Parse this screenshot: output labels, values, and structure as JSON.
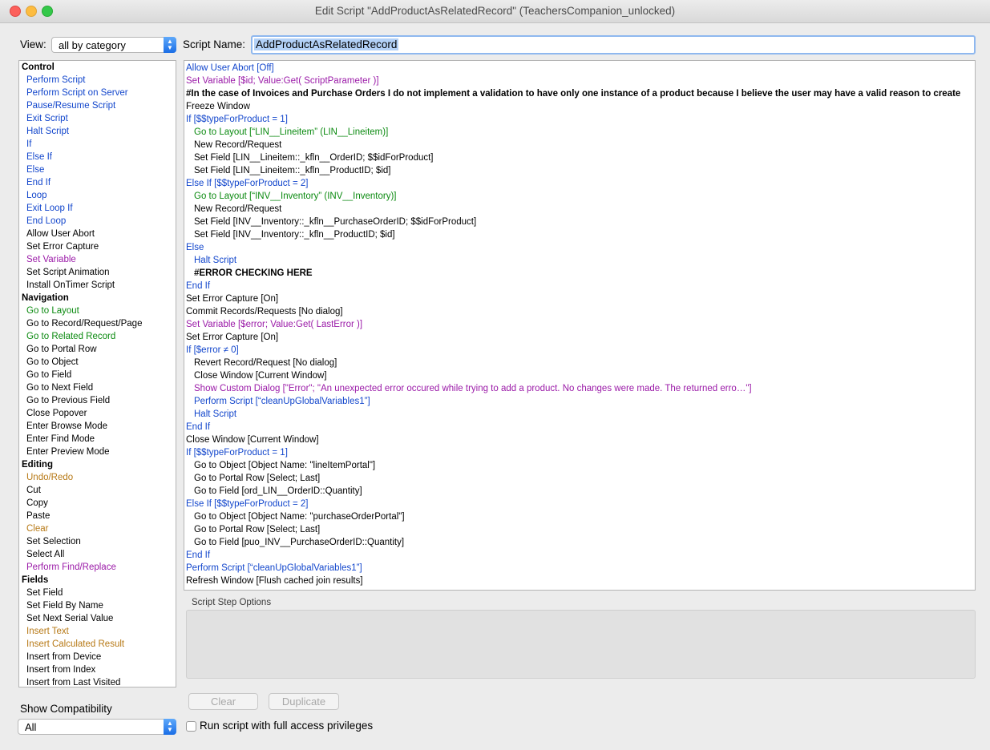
{
  "window": {
    "title": "Edit Script \"AddProductAsRelatedRecord\" (TeachersCompanion_unlocked)"
  },
  "view": {
    "label": "View:",
    "selected": "all by category"
  },
  "script_name": {
    "label": "Script Name:",
    "value": "AddProductAsRelatedRecord"
  },
  "steps": [
    {
      "text": "Control",
      "kind": "cat"
    },
    {
      "text": "Perform Script",
      "color": "blue"
    },
    {
      "text": "Perform Script on Server",
      "color": "blue"
    },
    {
      "text": "Pause/Resume Script",
      "color": "blue"
    },
    {
      "text": "Exit Script",
      "color": "blue"
    },
    {
      "text": "Halt Script",
      "color": "blue"
    },
    {
      "text": "If",
      "color": "blue"
    },
    {
      "text": "Else If",
      "color": "blue"
    },
    {
      "text": "Else",
      "color": "blue"
    },
    {
      "text": "End If",
      "color": "blue"
    },
    {
      "text": "Loop",
      "color": "blue"
    },
    {
      "text": "Exit Loop If",
      "color": "blue"
    },
    {
      "text": "End Loop",
      "color": "blue"
    },
    {
      "text": "Allow User Abort",
      "color": "black"
    },
    {
      "text": "Set Error Capture",
      "color": "black"
    },
    {
      "text": "Set Variable",
      "color": "purple"
    },
    {
      "text": "Set Script Animation",
      "color": "black"
    },
    {
      "text": "Install OnTimer Script",
      "color": "black"
    },
    {
      "text": "Navigation",
      "kind": "cat"
    },
    {
      "text": "Go to Layout",
      "color": "green"
    },
    {
      "text": "Go to Record/Request/Page",
      "color": "black"
    },
    {
      "text": "Go to Related Record",
      "color": "green"
    },
    {
      "text": "Go to Portal Row",
      "color": "black"
    },
    {
      "text": "Go to Object",
      "color": "black"
    },
    {
      "text": "Go to Field",
      "color": "black"
    },
    {
      "text": "Go to Next Field",
      "color": "black"
    },
    {
      "text": "Go to Previous Field",
      "color": "black"
    },
    {
      "text": "Close Popover",
      "color": "black"
    },
    {
      "text": "Enter Browse Mode",
      "color": "black"
    },
    {
      "text": "Enter Find Mode",
      "color": "black"
    },
    {
      "text": "Enter Preview Mode",
      "color": "black"
    },
    {
      "text": "Editing",
      "kind": "cat"
    },
    {
      "text": "Undo/Redo",
      "color": "orange"
    },
    {
      "text": "Cut",
      "color": "black"
    },
    {
      "text": "Copy",
      "color": "black"
    },
    {
      "text": "Paste",
      "color": "black"
    },
    {
      "text": "Clear",
      "color": "orange"
    },
    {
      "text": "Set Selection",
      "color": "black"
    },
    {
      "text": "Select All",
      "color": "black"
    },
    {
      "text": "Perform Find/Replace",
      "color": "purple"
    },
    {
      "text": "Fields",
      "kind": "cat"
    },
    {
      "text": "Set Field",
      "color": "black"
    },
    {
      "text": "Set Field By Name",
      "color": "black"
    },
    {
      "text": "Set Next Serial Value",
      "color": "black"
    },
    {
      "text": "Insert Text",
      "color": "orange"
    },
    {
      "text": "Insert Calculated Result",
      "color": "orange"
    },
    {
      "text": "Insert from Device",
      "color": "black"
    },
    {
      "text": "Insert from Index",
      "color": "black"
    },
    {
      "text": "Insert from Last Visited",
      "color": "black"
    }
  ],
  "script_lines": [
    {
      "text": "Allow User Abort [Off]",
      "color": "blue",
      "indent": 0
    },
    {
      "text": "Set Variable [$id; Value:Get( ScriptParameter )]",
      "color": "purple",
      "indent": 0
    },
    {
      "text": "#In the case of Invoices and Purchase Orders I do not implement a validation to have only one instance of a product because I believe the user may have a valid reason to create",
      "color": "black",
      "indent": 0,
      "bold": true
    },
    {
      "text": "Freeze Window",
      "color": "black",
      "indent": 0
    },
    {
      "text": "If [$$typeForProduct = 1]",
      "color": "blue",
      "indent": 0
    },
    {
      "text": "Go to Layout [“LIN__Lineitem” (LIN__Lineitem)]",
      "color": "green",
      "indent": 1
    },
    {
      "text": "New Record/Request",
      "color": "black",
      "indent": 1
    },
    {
      "text": "Set Field [LIN__Lineitem::_kfln__OrderID; $$idForProduct]",
      "color": "black",
      "indent": 1
    },
    {
      "text": "Set Field [LIN__Lineitem::_kfln__ProductID; $id]",
      "color": "black",
      "indent": 1
    },
    {
      "text": "Else If [$$typeForProduct = 2]",
      "color": "blue",
      "indent": 0
    },
    {
      "text": "Go to Layout [“INV__Inventory” (INV__Inventory)]",
      "color": "green",
      "indent": 1
    },
    {
      "text": "New Record/Request",
      "color": "black",
      "indent": 1
    },
    {
      "text": "Set Field [INV__Inventory::_kfln__PurchaseOrderID; $$idForProduct]",
      "color": "black",
      "indent": 1
    },
    {
      "text": "Set Field [INV__Inventory::_kfln__ProductID; $id]",
      "color": "black",
      "indent": 1
    },
    {
      "text": "Else",
      "color": "blue",
      "indent": 0
    },
    {
      "text": "Halt Script",
      "color": "blue",
      "indent": 1
    },
    {
      "text": "#ERROR CHECKING HERE",
      "color": "black",
      "indent": 1,
      "bold": true
    },
    {
      "text": "End If",
      "color": "blue",
      "indent": 0
    },
    {
      "text": "Set Error Capture [On]",
      "color": "black",
      "indent": 0
    },
    {
      "text": "Commit Records/Requests [No dialog]",
      "color": "black",
      "indent": 0
    },
    {
      "text": "Set Variable [$error; Value:Get( LastError )]",
      "color": "purple",
      "indent": 0
    },
    {
      "text": "Set Error Capture [On]",
      "color": "black",
      "indent": 0
    },
    {
      "text": "If [$error ≠ 0]",
      "color": "blue",
      "indent": 0
    },
    {
      "text": "Revert Record/Request [No dialog]",
      "color": "black",
      "indent": 1
    },
    {
      "text": "Close Window [Current Window]",
      "color": "black",
      "indent": 1
    },
    {
      "text": "Show Custom Dialog [\"Error\"; \"An unexpected error occured while trying to add a product. No changes were made. The returned erro…\"]",
      "color": "purple",
      "indent": 1
    },
    {
      "text": "Perform Script [“cleanUpGlobalVariables1”]",
      "color": "blue",
      "indent": 1
    },
    {
      "text": "Halt Script",
      "color": "blue",
      "indent": 1
    },
    {
      "text": "End If",
      "color": "blue",
      "indent": 0
    },
    {
      "text": "Close Window [Current Window]",
      "color": "black",
      "indent": 0
    },
    {
      "text": "If [$$typeForProduct = 1]",
      "color": "blue",
      "indent": 0
    },
    {
      "text": "Go to Object [Object Name: \"lineItemPortal\"]",
      "color": "black",
      "indent": 1
    },
    {
      "text": "Go to Portal Row [Select; Last]",
      "color": "black",
      "indent": 1
    },
    {
      "text": "Go to Field [ord_LIN__OrderID::Quantity]",
      "color": "black",
      "indent": 1
    },
    {
      "text": "Else If [$$typeForProduct = 2]",
      "color": "blue",
      "indent": 0
    },
    {
      "text": "Go to Object [Object Name: \"purchaseOrderPortal\"]",
      "color": "black",
      "indent": 1
    },
    {
      "text": "Go to Portal Row [Select; Last]",
      "color": "black",
      "indent": 1
    },
    {
      "text": "Go to Field [puo_INV__PurchaseOrderID::Quantity]",
      "color": "black",
      "indent": 1
    },
    {
      "text": "End If",
      "color": "blue",
      "indent": 0
    },
    {
      "text": "Perform Script [“cleanUpGlobalVariables1”]",
      "color": "blue",
      "indent": 0
    },
    {
      "text": "Refresh Window [Flush cached join results]",
      "color": "black",
      "indent": 0
    }
  ],
  "options": {
    "label": "Script Step Options"
  },
  "buttons": {
    "clear": "Clear",
    "duplicate": "Duplicate"
  },
  "compat": {
    "label": "Show Compatibility",
    "selected": "All"
  },
  "privileges": {
    "label": "Run script with full access privileges",
    "checked": false
  }
}
